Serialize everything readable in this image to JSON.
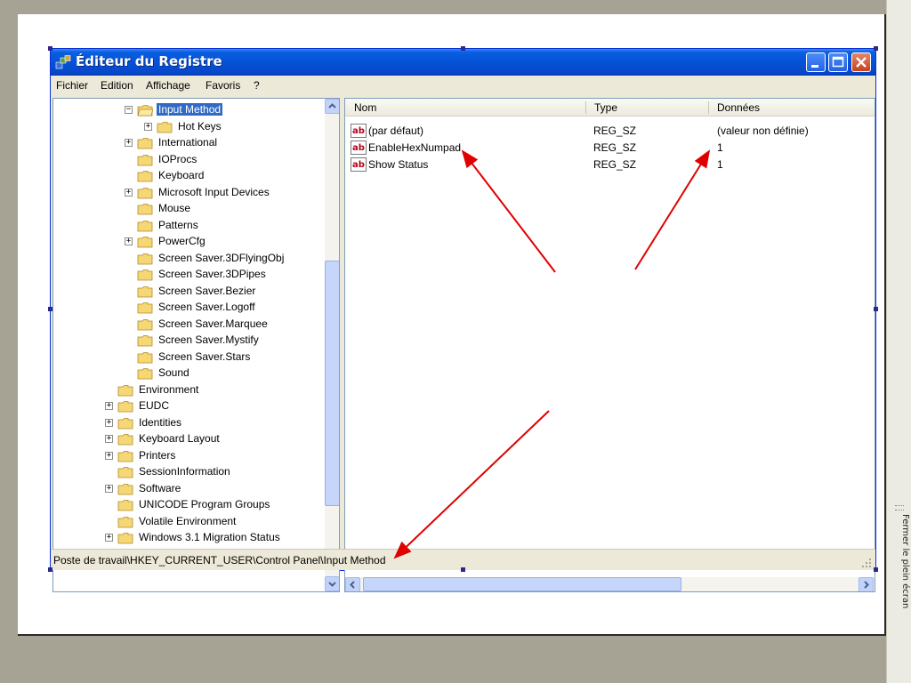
{
  "window": {
    "title": "Éditeur du Registre"
  },
  "menu": [
    "Fichier",
    "Edition",
    "Affichage",
    "Favoris",
    "?"
  ],
  "tree": [
    {
      "label": "Input Method",
      "level": 3,
      "expander": "−",
      "selected": true,
      "open": true
    },
    {
      "label": "Hot Keys",
      "level": 4,
      "expander": "+"
    },
    {
      "label": "International",
      "level": 3,
      "expander": "+"
    },
    {
      "label": "IOProcs",
      "level": 3,
      "expander": ""
    },
    {
      "label": "Keyboard",
      "level": 3,
      "expander": ""
    },
    {
      "label": "Microsoft Input Devices",
      "level": 3,
      "expander": "+"
    },
    {
      "label": "Mouse",
      "level": 3,
      "expander": ""
    },
    {
      "label": "Patterns",
      "level": 3,
      "expander": ""
    },
    {
      "label": "PowerCfg",
      "level": 3,
      "expander": "+"
    },
    {
      "label": "Screen Saver.3DFlyingObj",
      "level": 3,
      "expander": ""
    },
    {
      "label": "Screen Saver.3DPipes",
      "level": 3,
      "expander": ""
    },
    {
      "label": "Screen Saver.Bezier",
      "level": 3,
      "expander": ""
    },
    {
      "label": "Screen Saver.Logoff",
      "level": 3,
      "expander": ""
    },
    {
      "label": "Screen Saver.Marquee",
      "level": 3,
      "expander": ""
    },
    {
      "label": "Screen Saver.Mystify",
      "level": 3,
      "expander": ""
    },
    {
      "label": "Screen Saver.Stars",
      "level": 3,
      "expander": ""
    },
    {
      "label": "Sound",
      "level": 3,
      "expander": ""
    },
    {
      "label": "Environment",
      "level": 2,
      "expander": ""
    },
    {
      "label": "EUDC",
      "level": 2,
      "expander": "+"
    },
    {
      "label": "Identities",
      "level": 2,
      "expander": "+"
    },
    {
      "label": "Keyboard Layout",
      "level": 2,
      "expander": "+"
    },
    {
      "label": "Printers",
      "level": 2,
      "expander": "+"
    },
    {
      "label": "SessionInformation",
      "level": 2,
      "expander": ""
    },
    {
      "label": "Software",
      "level": 2,
      "expander": "+"
    },
    {
      "label": "UNICODE Program Groups",
      "level": 2,
      "expander": ""
    },
    {
      "label": "Volatile Environment",
      "level": 2,
      "expander": ""
    },
    {
      "label": "Windows 3.1 Migration Status",
      "level": 2,
      "expander": "+"
    }
  ],
  "list": {
    "columns": [
      "Nom",
      "Type",
      "Données"
    ],
    "rows": [
      {
        "name": "(par défaut)",
        "type": "REG_SZ",
        "data": "(valeur non définie)"
      },
      {
        "name": "EnableHexNumpad",
        "type": "REG_SZ",
        "data": "1"
      },
      {
        "name": "Show Status",
        "type": "REG_SZ",
        "data": "1"
      }
    ]
  },
  "status": {
    "path": "Poste de travail\\HKEY_CURRENT_USER\\Control Panel\\Input Method"
  },
  "fullscreen": {
    "label": "Fermer le plein écran"
  },
  "colors": {
    "annotation_arrow": "#e00000",
    "selection": "#316ac5",
    "titlebar": "#0552d6"
  }
}
